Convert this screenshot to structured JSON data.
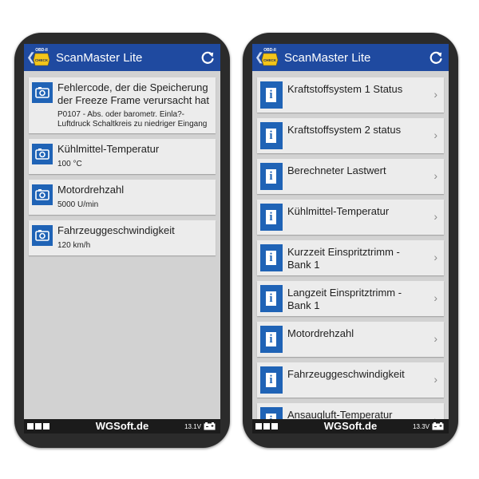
{
  "app": {
    "title": "ScanMaster Lite",
    "logo_text_top": "OBD-II",
    "logo_text_bottom": "CHECK",
    "back_icon": "chevron-left-icon",
    "refresh_icon": "refresh-icon",
    "accent_color": "#1f4aa0",
    "icon_color": "#1f63b6"
  },
  "left_screen": {
    "items": [
      {
        "title": "Fehlercode, der die Speicherung der Freeze Frame verursacht hat",
        "subtitle": "P0107 - Abs. oder barometr. Einla?-Luftdruck Schaltkreis zu niedriger Eingang",
        "icon": "camera-icon"
      },
      {
        "title": "Kühlmittel-Temperatur",
        "subtitle": "100 °C",
        "icon": "camera-icon"
      },
      {
        "title": "Motordrehzahl",
        "subtitle": "5000 U/min",
        "icon": "camera-icon"
      },
      {
        "title": "Fahrzeuggeschwindigkeit",
        "subtitle": "120 km/h",
        "icon": "camera-icon"
      }
    ]
  },
  "right_screen": {
    "items": [
      {
        "title": "Kraftstoffsystem 1 Status",
        "icon": "info-icon"
      },
      {
        "title": "Kraftstoffsystem 2 status",
        "icon": "info-icon"
      },
      {
        "title": "Berechneter Lastwert",
        "icon": "info-icon"
      },
      {
        "title": "Kühlmittel-Temperatur",
        "icon": "info-icon"
      },
      {
        "title": "Kurzzeit Einspritztrimm - Bank 1",
        "icon": "info-icon"
      },
      {
        "title": "Langzeit Einspritztrimm - Bank 1",
        "icon": "info-icon"
      },
      {
        "title": "Motordrehzahl",
        "icon": "info-icon"
      },
      {
        "title": "Fahrzeuggeschwindigkeit",
        "icon": "info-icon"
      },
      {
        "title": "Ansaugluft-Temperatur",
        "icon": "info-icon"
      }
    ]
  },
  "bottom_bar": {
    "brand": "WGSoft.de",
    "left": {
      "voltage": "13.1V"
    },
    "right": {
      "voltage": "13.3V"
    },
    "battery_icon": "battery-icon",
    "menu_icon": "grid-icon"
  }
}
